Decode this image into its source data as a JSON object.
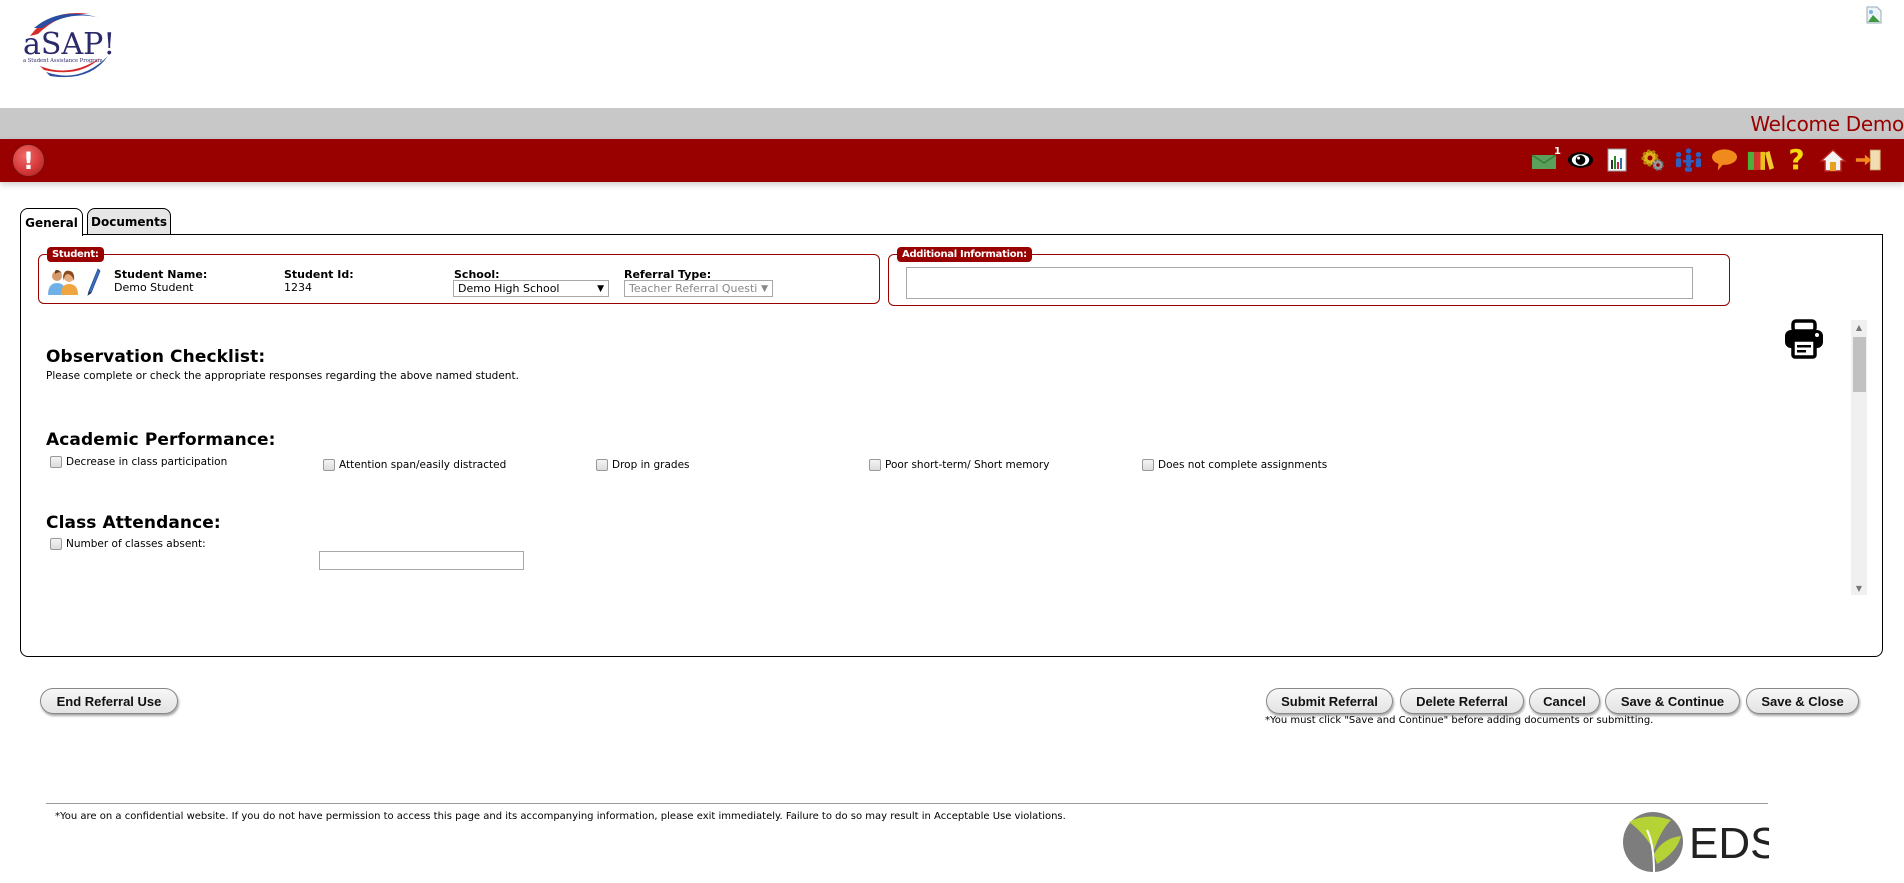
{
  "header": {
    "logo_title": "aSAP!",
    "logo_subtitle": "a Student Assistance Program",
    "welcome_text": "Welcome Demo"
  },
  "nav": {
    "alert_symbol": "!",
    "toolbar": [
      {
        "name": "messages-icon",
        "badge": "1"
      },
      {
        "name": "eye-icon"
      },
      {
        "name": "report-icon"
      },
      {
        "name": "settings-gear-icon"
      },
      {
        "name": "team-meeting-icon"
      },
      {
        "name": "chat-bubble-icon"
      },
      {
        "name": "books-icon"
      },
      {
        "name": "help-icon",
        "glyph": "?"
      },
      {
        "name": "home-icon"
      },
      {
        "name": "logout-icon"
      }
    ]
  },
  "tabs": [
    {
      "label": "General",
      "active": true
    },
    {
      "label": "Documents",
      "active": false
    }
  ],
  "student": {
    "legend": "Student:",
    "name_label": "Student Name:",
    "name_value": "Demo Student",
    "id_label": "Student Id:",
    "id_value": "1234",
    "school_label": "School:",
    "school_value": "Demo High School",
    "referral_type_label": "Referral Type:",
    "referral_type_value": "Teacher Referral Questionı"
  },
  "additional_info": {
    "legend": "Additional Information:",
    "value": ""
  },
  "checklist": {
    "title": "Observation Checklist:",
    "instructions": "Please complete or check the appropriate responses regarding the above named student.",
    "sections": [
      {
        "title": "Academic Performance:",
        "items": [
          {
            "label": "Decrease in class participation",
            "checked": false
          },
          {
            "label": "Attention span/easily distracted",
            "checked": false
          },
          {
            "label": "Drop in grades",
            "checked": false
          },
          {
            "label": "Poor short-term/ Short memory",
            "checked": false
          },
          {
            "label": "Does not complete assignments",
            "checked": false
          }
        ]
      },
      {
        "title": "Class Attendance:",
        "items": [
          {
            "label": "Number of classes absent:",
            "checked": false,
            "input_value": ""
          }
        ]
      }
    ]
  },
  "buttons": {
    "end_referral": "End Referral Use",
    "submit": "Submit Referral",
    "delete": "Delete Referral",
    "cancel": "Cancel",
    "save_continue": "Save & Continue",
    "save_close": "Save & Close"
  },
  "note": "*You must click \"Save and Continue\" before adding documents or submitting.",
  "footer": {
    "disclaimer": "*You are on a confidential website. If you do not have permission to access this page and its accompanying information, please exit immediately. Failure to do so may result in Acceptable Use violations.",
    "brand": "EDS"
  },
  "colors": {
    "brand_red": "#990000",
    "welcome_bar": "#c8c8c8",
    "eds_green": "#b5d334"
  }
}
